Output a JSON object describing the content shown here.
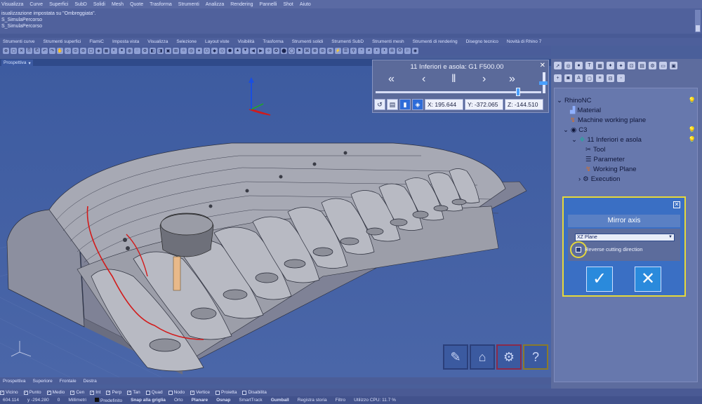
{
  "menubar": [
    "Visualizza",
    "Curve",
    "Superfici",
    "SubD",
    "Solidi",
    "Mesh",
    "Quote",
    "Trasforma",
    "Strumenti",
    "Analizza",
    "Rendering",
    "Pannelli",
    "Shot",
    "Aiuto"
  ],
  "history": [
    "isualizzazione impostata su \"Ombreggiata\".",
    "S_SimulaPercorso",
    "S_SimulaPercorso"
  ],
  "tabs": [
    "Strumenti curve",
    "Strumenti superfici",
    "FlamiC",
    "Imposta vista",
    "Visualizza",
    "Selezione",
    "Layout viste",
    "Visibilità",
    "Trasforma",
    "Strumenti solidi",
    "Strumenti SubD",
    "Strumenti mesh",
    "Strumenti di rendering",
    "Disegno tecnico",
    "Novità di Rhino 7"
  ],
  "viewport": {
    "name": "Prospettiva"
  },
  "sim": {
    "title": "11 Inferiori e asola: G1 F500.00",
    "progress": 0.86,
    "x": "X: 195.644",
    "y": "Y: -372.065",
    "z": "Z: -144.510"
  },
  "tree": {
    "root": "RhinoNC",
    "material": "Material",
    "mwp": "Machine working plane",
    "c3": "C3",
    "op": "11 Inferiori e asola",
    "tool": "Tool",
    "parameter": "Parameter",
    "wp": "Working Plane",
    "exec": "Execution"
  },
  "mirror": {
    "title": "Mirror axis",
    "plane": "XZ Plane",
    "reverse": "Reverse cutting direction"
  },
  "bottom_tabs": [
    "Prospettiva",
    "Superiore",
    "Frontale",
    "Destra"
  ],
  "osnaps": [
    "Vicino",
    "Punto",
    "Medio",
    "Cen",
    "Int",
    "Perp",
    "Tan",
    "Quad",
    "Nodo",
    "Vertice",
    "Proietta",
    "Disabilita"
  ],
  "osnap_checked": [
    true,
    true,
    true,
    true,
    true,
    true,
    true,
    false,
    false,
    true,
    false,
    false
  ],
  "status": {
    "x": "604.114",
    "y": "y -294.280",
    "z": "0",
    "units": "Millimetri",
    "layer": "Predefinito",
    "items": [
      "Snap alla griglia",
      "Orto",
      "Planare",
      "Osnap",
      "SmartTrack",
      "Gumball",
      "Registra storia",
      "Filtro",
      "Utilizzo CPU: 11.7 %"
    ]
  }
}
